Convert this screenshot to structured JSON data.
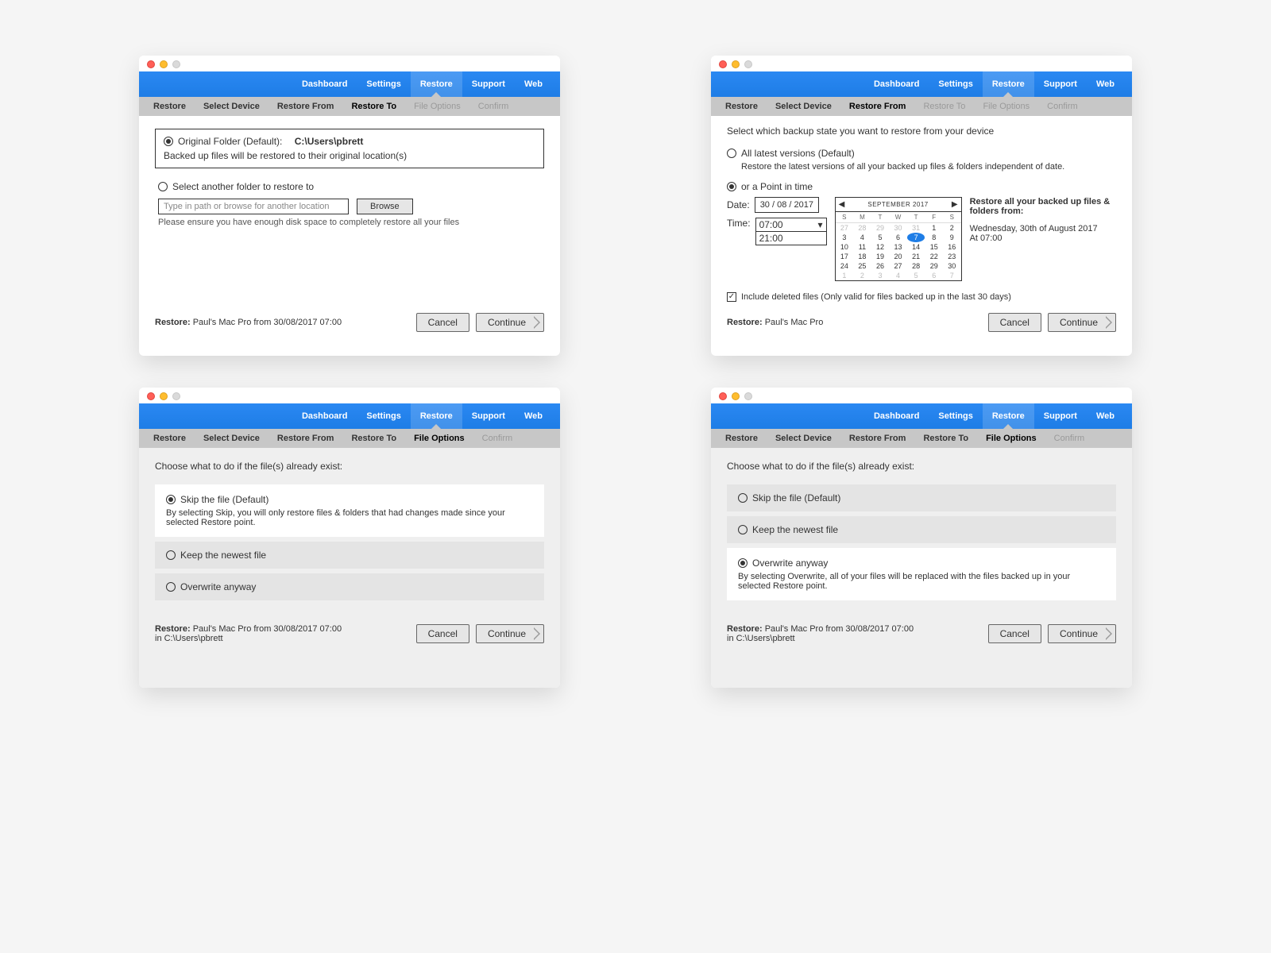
{
  "nav": [
    "Dashboard",
    "Settings",
    "Restore",
    "Support",
    "Web"
  ],
  "nav_active": "Restore",
  "subnav": [
    "Restore",
    "Select Device",
    "Restore From",
    "Restore To",
    "File Options",
    "Confirm"
  ],
  "buttons": {
    "cancel": "Cancel",
    "continue": "Continue",
    "browse": "Browse"
  },
  "tl": {
    "current": "Restore To",
    "opt1_label": "Original Folder (Default):",
    "opt1_path": "C:\\Users\\pbrett",
    "opt1_desc": "Backed up files will be restored to their original location(s)",
    "opt2_label": "Select another folder to restore to",
    "path_placeholder": "Type in path or browse for another location",
    "note": "Please ensure you have enough disk space to completely restore all your files",
    "status_prefix": "Restore:",
    "status": "Paul's Mac Pro from 30/08/2017 07:00"
  },
  "tr": {
    "current": "Restore From",
    "intro": "Select which backup state you want to restore from your device",
    "opt_latest_label": "All latest versions (Default)",
    "opt_latest_desc": "Restore the latest versions of all your backed up files & folders independent of date.",
    "opt_point_label": "or a Point in time",
    "date_label": "Date:",
    "date_value": "30 / 08 / 2017",
    "time_label": "Time:",
    "time_value": "07:00",
    "time_alt": "21:00",
    "cal_title": "SEPTEMBER 2017",
    "cal_dow": [
      "S",
      "M",
      "T",
      "W",
      "T",
      "F",
      "S"
    ],
    "cal_rows": [
      [
        {
          "d": 27,
          "o": 1
        },
        {
          "d": 28,
          "o": 1
        },
        {
          "d": 29,
          "o": 1
        },
        {
          "d": 30,
          "o": 1
        },
        {
          "d": 31,
          "o": 1
        },
        {
          "d": 1
        },
        {
          "d": 2
        }
      ],
      [
        {
          "d": 3
        },
        {
          "d": 4
        },
        {
          "d": 5
        },
        {
          "d": 6
        },
        {
          "d": 7,
          "s": 1
        },
        {
          "d": 8
        },
        {
          "d": 9
        }
      ],
      [
        {
          "d": 10
        },
        {
          "d": 11
        },
        {
          "d": 12
        },
        {
          "d": 13
        },
        {
          "d": 14
        },
        {
          "d": 15
        },
        {
          "d": 16
        }
      ],
      [
        {
          "d": 17
        },
        {
          "d": 18
        },
        {
          "d": 19
        },
        {
          "d": 20
        },
        {
          "d": 21
        },
        {
          "d": 22
        },
        {
          "d": 23
        }
      ],
      [
        {
          "d": 24
        },
        {
          "d": 25
        },
        {
          "d": 26
        },
        {
          "d": 27
        },
        {
          "d": 28
        },
        {
          "d": 29
        },
        {
          "d": 30
        }
      ],
      [
        {
          "d": 1,
          "o": 1
        },
        {
          "d": 2,
          "o": 1
        },
        {
          "d": 3,
          "o": 1
        },
        {
          "d": 4,
          "o": 1
        },
        {
          "d": 5,
          "o": 1
        },
        {
          "d": 6,
          "o": 1
        },
        {
          "d": 7,
          "o": 1
        }
      ]
    ],
    "summary_title": "Restore all your backed up files & folders from:",
    "summary_date": "Wednesday, 30th of August 2017",
    "summary_time": "At 07:00",
    "include_deleted": "Include deleted files (Only valid for files backed up in the last 30 days)",
    "status_prefix": "Restore:",
    "status": "Paul's Mac Pro"
  },
  "bl": {
    "current": "File Options",
    "intro": "Choose what to do if the file(s) already exist:",
    "opt_skip": "Skip the file (Default)",
    "opt_skip_desc": "By selecting Skip, you will only restore files & folders that had changes made since your selected Restore point.",
    "opt_keep": "Keep the newest file",
    "opt_over": "Overwrite anyway",
    "status_prefix": "Restore:",
    "status_line1": "Paul's Mac Pro from 30/08/2017 07:00",
    "status_line2": "in C:\\Users\\pbrett"
  },
  "br": {
    "current": "File Options",
    "intro": "Choose what to do if the file(s) already exist:",
    "opt_skip": "Skip the file (Default)",
    "opt_keep": "Keep the newest file",
    "opt_over": "Overwrite anyway",
    "opt_over_desc": "By selecting Overwrite, all of your files will be replaced with the files backed up in your selected Restore point.",
    "status_prefix": "Restore:",
    "status_line1": "Paul's Mac Pro from 30/08/2017 07:00",
    "status_line2": "in C:\\Users\\pbrett"
  }
}
